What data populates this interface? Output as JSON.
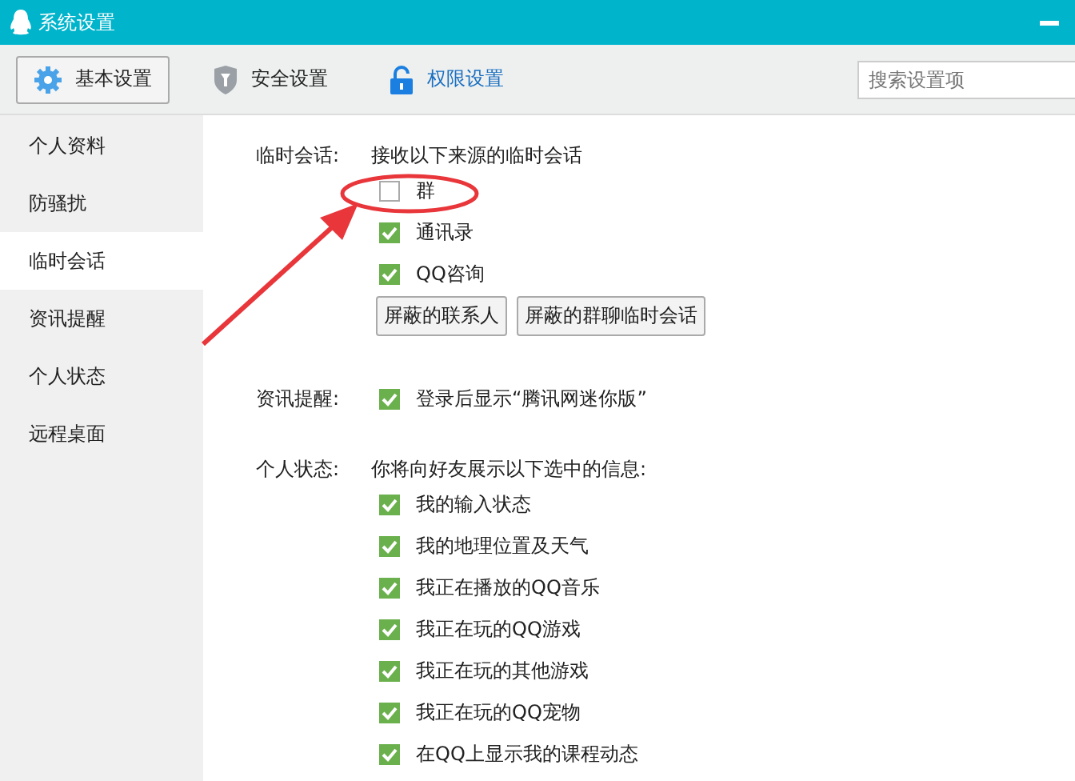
{
  "window": {
    "title": "系统设置"
  },
  "tabs": [
    {
      "label": "基本设置",
      "selected": true,
      "accent": false
    },
    {
      "label": "安全设置",
      "selected": false,
      "accent": false
    },
    {
      "label": "权限设置",
      "selected": false,
      "accent": true
    }
  ],
  "search": {
    "placeholder": "搜索设置项"
  },
  "sidebar": {
    "items": [
      {
        "label": "个人资料",
        "selected": false
      },
      {
        "label": "防骚扰",
        "selected": false
      },
      {
        "label": "临时会话",
        "selected": true
      },
      {
        "label": "资讯提醒",
        "selected": false
      },
      {
        "label": "个人状态",
        "selected": false
      },
      {
        "label": "远程桌面",
        "selected": false
      }
    ]
  },
  "sections": [
    {
      "label": "临时会话:",
      "description": "接收以下来源的临时会话",
      "options": [
        {
          "label": "群",
          "checked": false
        },
        {
          "label": "通讯录",
          "checked": true
        },
        {
          "label": "QQ咨询",
          "checked": true
        }
      ],
      "buttons": [
        "屏蔽的联系人",
        "屏蔽的群聊临时会话"
      ]
    },
    {
      "label": "资讯提醒:",
      "options": [
        {
          "label": "登录后显示“腾讯网迷你版”",
          "checked": true
        }
      ]
    },
    {
      "label": "个人状态:",
      "description": "你将向好友展示以下选中的信息:",
      "options": [
        {
          "label": "我的输入状态",
          "checked": true
        },
        {
          "label": "我的地理位置及天气",
          "checked": true
        },
        {
          "label": "我正在播放的QQ音乐",
          "checked": true
        },
        {
          "label": "我正在玩的QQ游戏",
          "checked": true
        },
        {
          "label": "我正在玩的其他游戏",
          "checked": true
        },
        {
          "label": "我正在玩的QQ宠物",
          "checked": true
        },
        {
          "label": "在QQ上显示我的课程动态",
          "checked": true
        }
      ]
    }
  ]
}
